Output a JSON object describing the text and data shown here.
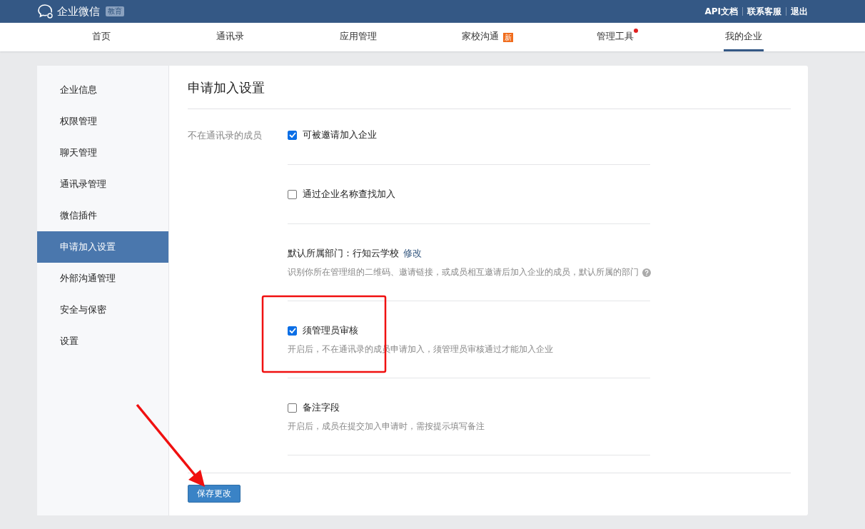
{
  "topbar": {
    "brand": "企业微信",
    "brand_badge": "教育",
    "links": [
      "API文档",
      "联系客服",
      "退出"
    ]
  },
  "nav": [
    {
      "label": "首页",
      "selected": false
    },
    {
      "label": "通讯录",
      "selected": false
    },
    {
      "label": "应用管理",
      "selected": false
    },
    {
      "label": "家校沟通",
      "selected": false,
      "badge": "新"
    },
    {
      "label": "管理工具",
      "selected": false,
      "dot": true
    },
    {
      "label": "我的企业",
      "selected": true
    }
  ],
  "sidebar": {
    "items": [
      {
        "label": "企业信息",
        "selected": false
      },
      {
        "label": "权限管理",
        "selected": false
      },
      {
        "label": "聊天管理",
        "selected": false
      },
      {
        "label": "通讯录管理",
        "selected": false
      },
      {
        "label": "微信插件",
        "selected": false
      },
      {
        "label": "申请加入设置",
        "selected": true
      },
      {
        "label": "外部沟通管理",
        "selected": false
      },
      {
        "label": "安全与保密",
        "selected": false
      },
      {
        "label": "设置",
        "selected": false
      }
    ]
  },
  "main": {
    "title": "申请加入设置",
    "row_label": "不在通讯录的成员",
    "options": [
      {
        "kind": "checkbox",
        "label": "可被邀请加入企业",
        "checked": true
      },
      {
        "kind": "checkbox",
        "label": "通过企业名称查找加入",
        "checked": false
      },
      {
        "kind": "info",
        "label": "默认所属部门：行知云学校",
        "link": "修改",
        "description": "识别你所在管理组的二维码、邀请链接，或成员相互邀请后加入企业的成员，默认所属的部门",
        "help": true
      },
      {
        "kind": "checkbox",
        "label": "须管理员审核",
        "checked": true,
        "description": "开启后，不在通讯录的成员申请加入，须管理员审核通过才能加入企业"
      },
      {
        "kind": "checkbox",
        "label": "备注字段",
        "checked": false,
        "description": "开启后，成员在提交加入申请时，需按提示填写备注"
      }
    ],
    "save_button": "保存更改"
  }
}
